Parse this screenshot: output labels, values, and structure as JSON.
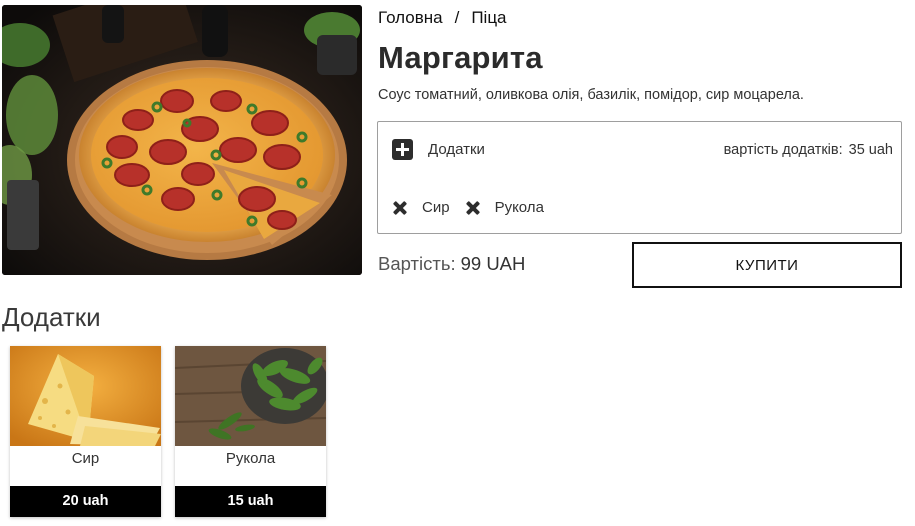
{
  "breadcrumb": {
    "home": "Головна",
    "separator": "/",
    "category": "Піца"
  },
  "product": {
    "title": "Маргарита",
    "description": "Соус томатний, оливкова олія, базилік, помідор, сир моцарела.",
    "price_label": "Вартість:",
    "price_value": "99 UAH",
    "buy_label": "КУПИТИ"
  },
  "addons_box": {
    "toggle_label": "Додатки",
    "toggle_icon": "plus-square-icon",
    "cost_label": "вартість додатків:",
    "cost_value": "35 uah",
    "selected": [
      {
        "label": "Сир",
        "remove_icon": "close-icon"
      },
      {
        "label": "Рукола",
        "remove_icon": "close-icon"
      }
    ]
  },
  "addons_section": {
    "title": "Додатки",
    "items": [
      {
        "name": "Сир",
        "price": "20 uah"
      },
      {
        "name": "Рукола",
        "price": "15 uah"
      }
    ]
  },
  "colors": {
    "text": "#212121",
    "border": "#9e9e9e",
    "price_bar": "#000000",
    "icon": "#2d2d2d"
  }
}
